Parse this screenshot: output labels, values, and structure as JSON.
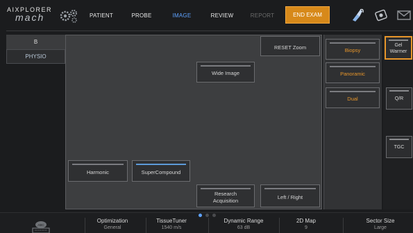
{
  "brand": {
    "line1": "AIXPLORER",
    "line2": "mach",
    "reg": "®"
  },
  "nav": [
    {
      "label": "PATIENT",
      "state": "normal"
    },
    {
      "label": "PROBE",
      "state": "normal"
    },
    {
      "label": "IMAGE",
      "state": "active"
    },
    {
      "label": "REVIEW",
      "state": "normal"
    },
    {
      "label": "REPORT",
      "state": "disabled"
    }
  ],
  "end_exam": "END EXAM",
  "tabs": {
    "b": "B",
    "physio": "PHYSIO"
  },
  "buttons": {
    "reset_zoom": "RESET Zoom",
    "wide_image": "Wide Image",
    "harmonic": "Harmonic",
    "supercompound": "SuperCompound",
    "research_1": "Research",
    "research_2": "Acquisition",
    "left_right": "Left / Right"
  },
  "modes": {
    "biopsy": "Biopsy",
    "panoramic": "Panoramic",
    "dual": "Dual"
  },
  "side": {
    "gel_1": "Gel",
    "gel_2": "Warmer",
    "qr": "Q/R",
    "tgc": "TGC"
  },
  "bottom": [
    {
      "label": "Optimization",
      "value": "General"
    },
    {
      "label": "TissueTuner",
      "value": "1540 m/s"
    },
    {
      "label": "Dynamic Range",
      "value": "63 dB"
    },
    {
      "label": "2D Map",
      "value": "9"
    },
    {
      "label": "Sector Size",
      "value": "Large"
    }
  ],
  "colors": {
    "accent": "#e8962a",
    "active": "#5ea2ff",
    "selected_bar": "#5d9ad8"
  }
}
